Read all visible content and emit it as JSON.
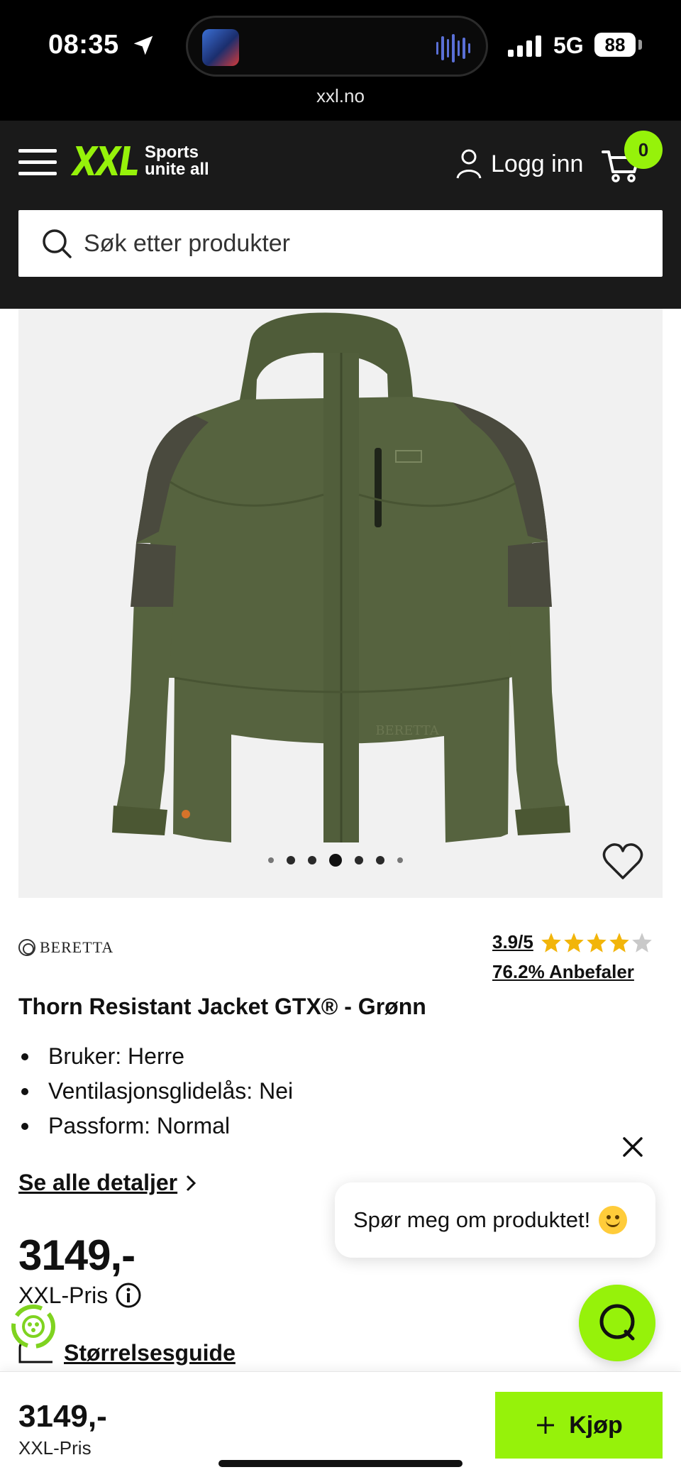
{
  "status_bar": {
    "time": "08:35",
    "network": "5G",
    "battery": "88",
    "url": "xxl.no"
  },
  "header": {
    "logo": "XXL",
    "tagline_line1": "Sports",
    "tagline_line2": "unite all",
    "login_label": "Logg inn",
    "cart_count": "0",
    "search_placeholder": "Søk etter produkter"
  },
  "product": {
    "brand": "BERETTA",
    "rating": "3.9/5",
    "rating_value": 3.9,
    "rating_max": 5,
    "recommend": "76.2% Anbefaler",
    "title": "Thorn Resistant Jacket GTX® - Grønn",
    "specs": [
      "Bruker: Herre",
      "Ventilasjonsglidelås: Nei",
      "Passform: Normal"
    ],
    "details_link": "Se alle detaljer",
    "price": "3149,-",
    "price_label": "XXL-Pris",
    "size_guide": "Størrelsesguide",
    "image_count": 7,
    "active_image": 4
  },
  "chat": {
    "prompt": "Spør meg om produktet!"
  },
  "buy_bar": {
    "price": "3149,-",
    "price_label": "XXL-Pris",
    "buy_label": "Kjøp"
  },
  "colors": {
    "accent": "#96f20a",
    "header_bg": "#1a1a1a",
    "jacket": "#56633f"
  }
}
